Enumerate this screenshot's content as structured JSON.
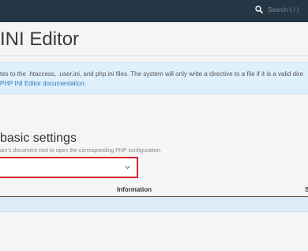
{
  "header": {
    "search_placeholder": "Search ( / )",
    "search_icon": "search-icon"
  },
  "page": {
    "title": "INI Editor"
  },
  "notice": {
    "line1": "tes to the .htaccess, .user.ini, and php.ini files. The system will only write a directive to a file if it is a valid dire",
    "link": "PHP INI Editor documentation."
  },
  "basic": {
    "title": "basic settings",
    "help": "ain’s document root to open the corresponding PHP configuration.",
    "select_value": ""
  },
  "table": {
    "header_information": "Information",
    "header_partial": "S"
  }
}
